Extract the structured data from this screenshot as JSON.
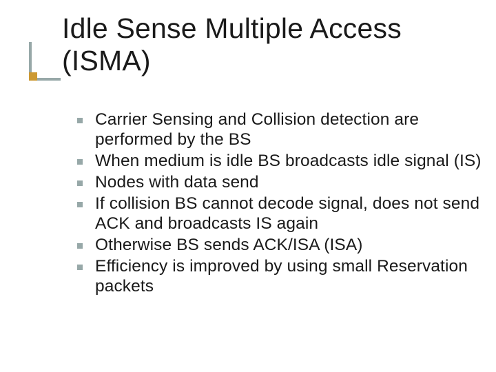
{
  "slide": {
    "title": "Idle Sense Multiple Access (ISMA)",
    "bullets": [
      "Carrier Sensing and Collision detection are performed by the BS",
      "When medium is idle BS broadcasts idle signal (IS)",
      "Nodes with data send",
      "If collision BS cannot decode signal, does not send ACK and broadcasts IS again",
      "Otherwise BS sends ACK/ISA  (ISA)",
      "Efficiency is improved by using small Reservation packets"
    ]
  }
}
